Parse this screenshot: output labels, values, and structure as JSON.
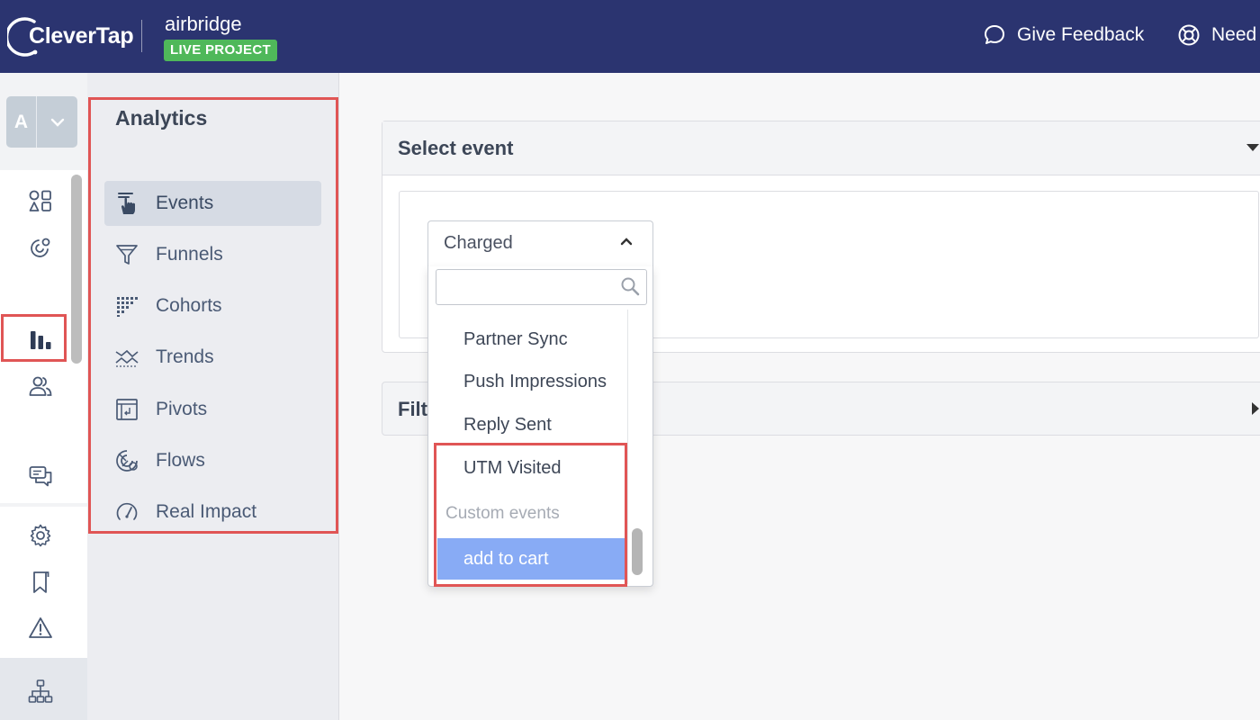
{
  "header": {
    "logo_text": "CleverTap",
    "project_name": "airbridge",
    "project_badge": "LIVE PROJECT",
    "feedback_label": "Give Feedback",
    "help_label": "Need",
    "colors": {
      "background": "#2b3470",
      "badge": "#4fb85a"
    }
  },
  "rail": {
    "account_letter": "A",
    "icons": [
      "dashboard-icon",
      "engage-icon",
      "analytics-icon",
      "segments-icon",
      "messages-icon",
      "settings-icon",
      "bookmark-icon",
      "alert-icon",
      "hierarchy-icon"
    ],
    "active": "analytics-icon"
  },
  "submenu": {
    "title": "Analytics",
    "items": [
      {
        "label": "Events",
        "icon": "tap-icon",
        "active": true
      },
      {
        "label": "Funnels",
        "icon": "funnel-icon",
        "active": false
      },
      {
        "label": "Cohorts",
        "icon": "cohort-grid-icon",
        "active": false
      },
      {
        "label": "Trends",
        "icon": "trends-icon",
        "active": false
      },
      {
        "label": "Pivots",
        "icon": "pivot-icon",
        "active": false
      },
      {
        "label": "Flows",
        "icon": "flows-icon",
        "active": false
      },
      {
        "label": "Real Impact",
        "icon": "gauge-icon",
        "active": false
      }
    ]
  },
  "main": {
    "select_event_title": "Select event",
    "filter_title": "Filt",
    "filter_suffix": ")",
    "select": {
      "value": "Charged",
      "search_placeholder": "",
      "items": [
        "Partner Sync",
        "Push Impressions",
        "Reply Sent",
        "UTM Visited"
      ],
      "group_label": "Custom events",
      "custom_items": [
        "add to cart"
      ],
      "selected": "add to cart"
    }
  },
  "accent_colors": {
    "highlight_box": "#e05555",
    "selected_option": "#88abf5"
  }
}
